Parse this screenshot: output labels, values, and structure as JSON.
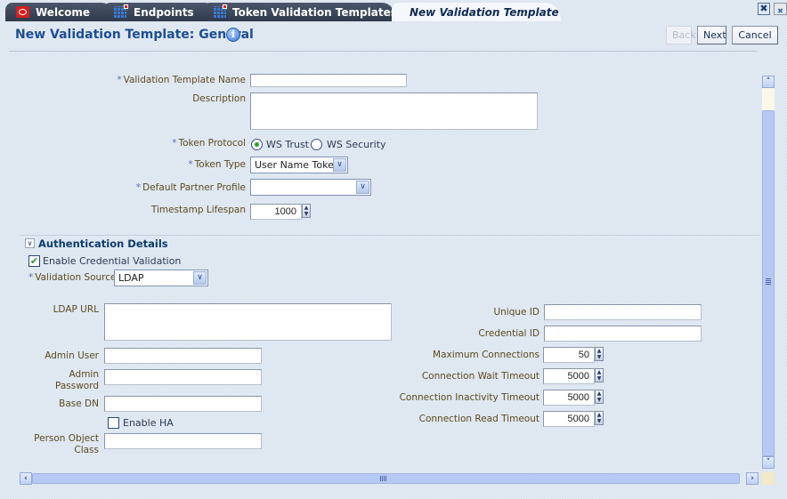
{
  "tabs": [
    {
      "label": "Welcome",
      "icon": "oracle-logo-icon"
    },
    {
      "label": "Endpoints",
      "icon": "grid-icon"
    },
    {
      "label": "Token Validation Templates",
      "icon": "grid-icon"
    },
    {
      "label": "New Validation Template",
      "active": true
    }
  ],
  "window_controls": {
    "close_tab": "close-tab-icon",
    "close_all": "close-all-icon"
  },
  "header": {
    "title": "New Validation Template: General",
    "info_icon": "i",
    "back_label": "Back",
    "next_label": "Next",
    "cancel_label": "Cancel"
  },
  "general": {
    "name_label": "Validation Template Name",
    "name_value": "",
    "description_label": "Description",
    "description_value": "",
    "token_protocol_label": "Token Protocol",
    "protocol_options": [
      "WS Trust",
      "WS Security"
    ],
    "protocol_selected": "WS Trust",
    "token_type_label": "Token Type",
    "token_type_value": "User Name Token",
    "partner_profile_label": "Default Partner Profile",
    "partner_profile_value": "",
    "timestamp_label": "Timestamp Lifespan",
    "timestamp_value": "1000"
  },
  "auth": {
    "section_title": "Authentication Details",
    "collapse_glyph": "∨",
    "enable_cred_label": "Enable Credential Validation",
    "enable_cred_checked": true,
    "check_glyph": "✔",
    "validation_source_label": "Validation Source",
    "validation_source_value": "LDAP",
    "ldap_url_label": "LDAP URL",
    "ldap_url_value": "",
    "admin_user_label": "Admin User",
    "admin_user_value": "",
    "admin_password_label_1": "Admin",
    "admin_password_label_2": "Password",
    "admin_password_value": "",
    "base_dn_label": "Base DN",
    "base_dn_value": "",
    "enable_ha_label": "Enable HA",
    "enable_ha_checked": false,
    "person_object_label_1": "Person Object",
    "person_object_label_2": "Class",
    "person_object_value": "",
    "unique_id_label": "Unique ID",
    "unique_id_value": "",
    "credential_id_label": "Credential ID",
    "credential_id_value": "",
    "max_conn_label": "Maximum Connections",
    "max_conn_value": "50",
    "wait_timeout_label": "Connection Wait Timeout",
    "wait_timeout_value": "5000",
    "inactivity_timeout_label": "Connection Inactivity Timeout",
    "inactivity_timeout_value": "5000",
    "read_timeout_label": "Connection Read Timeout",
    "read_timeout_value": "5000"
  },
  "glyphs": {
    "required": "*",
    "dropdown": "∨",
    "spin_up": "▲",
    "spin_down": "▼",
    "up": "˄",
    "down": "˅",
    "left": "‹",
    "right": "›",
    "close": "✖"
  }
}
